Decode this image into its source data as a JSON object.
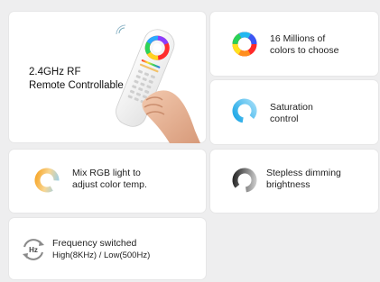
{
  "cards": {
    "remote": {
      "line1": "2.4GHz RF",
      "line2": "Remote Controllable"
    },
    "colors": {
      "line1": "16 Millions of",
      "line2": "colors to choose"
    },
    "saturation": {
      "line1": "Saturation",
      "line2": "control"
    },
    "color_temp": {
      "line1": "Mix RGB light to",
      "line2": "adjust color temp."
    },
    "dimming": {
      "line1": "Stepless dimming",
      "line2": "brightness"
    },
    "frequency": {
      "line1": "Frequency switched",
      "line2": "High(8KHz) / Low(500Hz)",
      "icon_text": "Hz"
    }
  },
  "colors": {
    "page_bg": "#eeeeef",
    "card_bg": "#ffffff",
    "saturation_blue": "#1aa6e6",
    "warm": "#f7b038",
    "cool": "#8fcff3"
  },
  "icons": {
    "remote": "remote-control-icon",
    "colors": "color-wheel-icon",
    "saturation": "saturation-ring-icon",
    "color_temp": "color-temp-ring-icon",
    "dimming": "dimming-ring-icon",
    "frequency": "frequency-cycle-icon"
  }
}
